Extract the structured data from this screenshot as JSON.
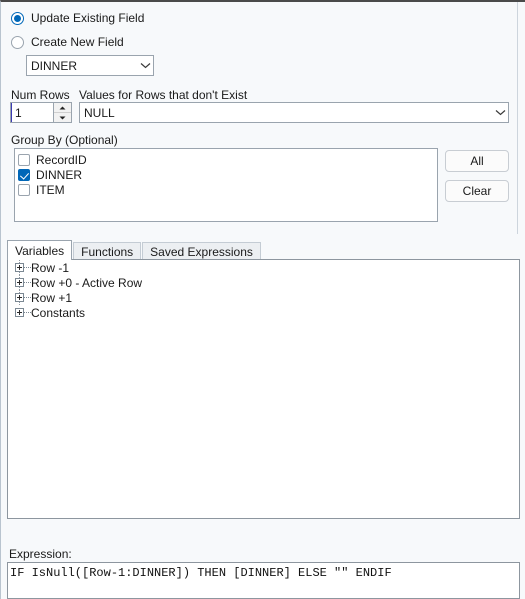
{
  "mode": {
    "update_existing_label": "Update Existing Field",
    "create_new_label": "Create New  Field",
    "selected": "update_existing"
  },
  "field_select": {
    "value": "DINNER",
    "chevron_icon": "chevron-down-icon"
  },
  "num_rows": {
    "label": "Num Rows",
    "value": "1",
    "up_icon": "caret-up-icon",
    "down_icon": "caret-down-icon"
  },
  "values_missing": {
    "label": "Values for Rows that don't Exist",
    "value": "NULL",
    "chevron_icon": "chevron-down-icon"
  },
  "group_by": {
    "label": "Group By (Optional)",
    "items": [
      {
        "label": "RecordID",
        "checked": false
      },
      {
        "label": "DINNER",
        "checked": true
      },
      {
        "label": "ITEM",
        "checked": false
      }
    ],
    "all_button": "All",
    "clear_button": "Clear"
  },
  "tabs": [
    {
      "label": "Variables",
      "active": true
    },
    {
      "label": "Functions",
      "active": false
    },
    {
      "label": "Saved Expressions",
      "active": false
    }
  ],
  "tree": {
    "nodes": [
      {
        "label": "Row -1"
      },
      {
        "label": "Row +0 - Active Row"
      },
      {
        "label": "Row +1"
      },
      {
        "label": "Constants"
      }
    ],
    "expander_icon": "plus-box-icon"
  },
  "expression": {
    "label": "Expression:",
    "value": "IF IsNull([Row-1:DINNER]) THEN [DINNER] ELSE \"\" ENDIF"
  },
  "colors": {
    "accent": "#0067b8",
    "panel_background": "#f7f9fb",
    "field_background": "#ffffff"
  }
}
